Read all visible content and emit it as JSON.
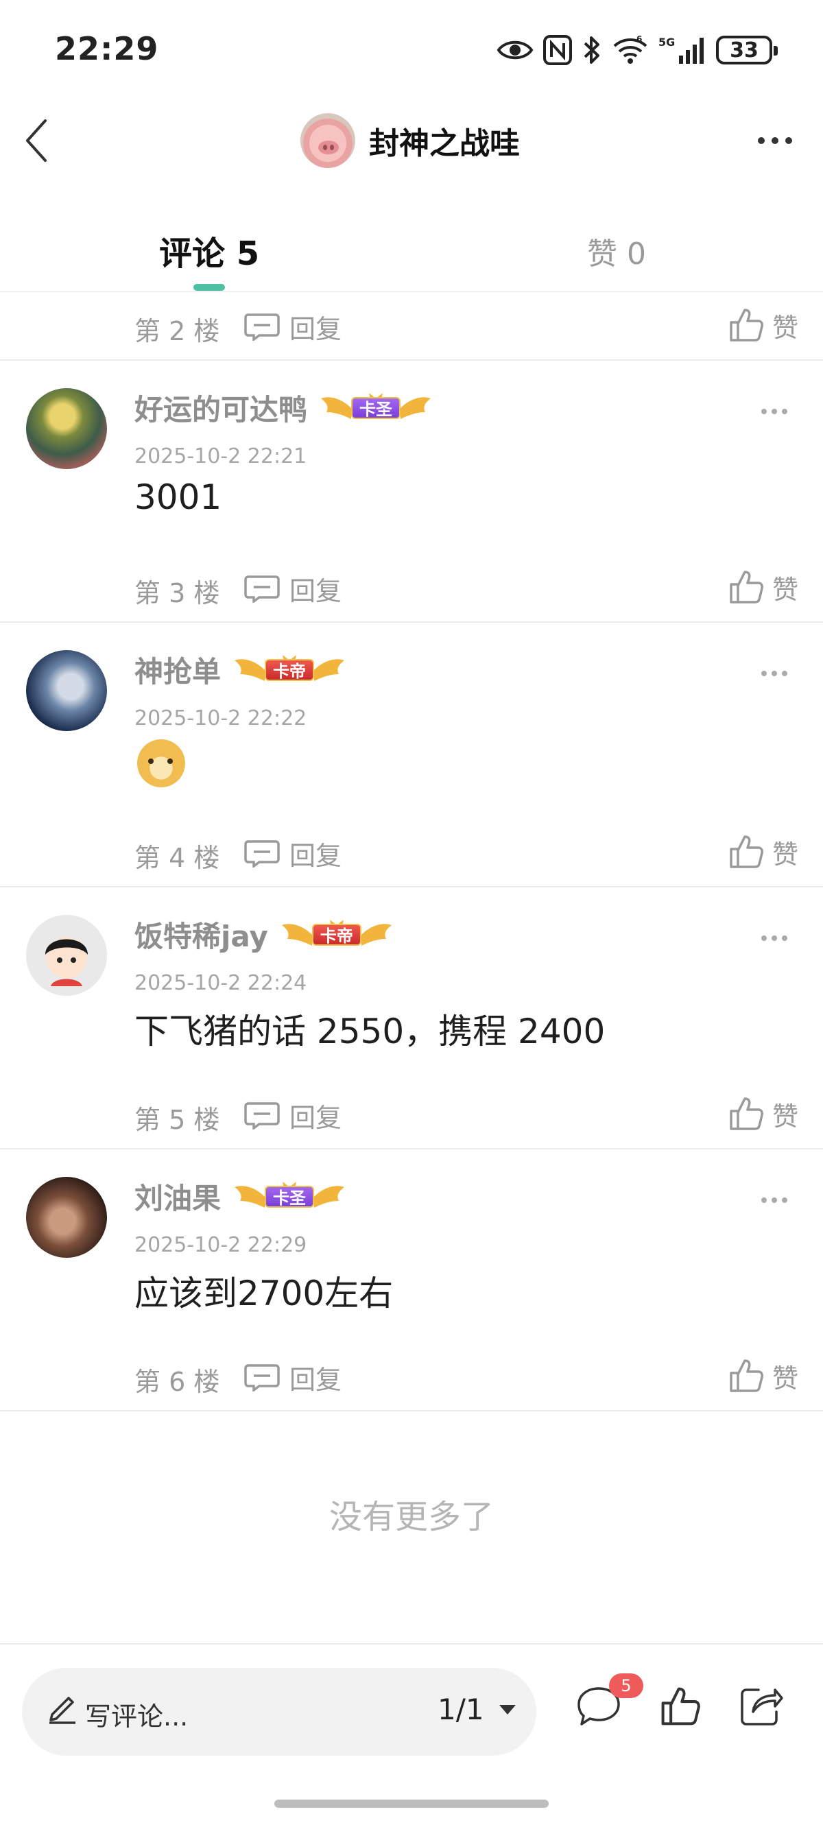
{
  "status_bar": {
    "time": "22:29",
    "battery": "33",
    "icons": [
      "eye-icon",
      "nfc-icon",
      "bluetooth-icon",
      "wifi-icon",
      "5g-signal-icon",
      "battery-icon"
    ]
  },
  "header": {
    "title": "封神之战哇",
    "back_icon": "chevron-left-icon",
    "more_icon": "more-dots-icon"
  },
  "tabs": [
    {
      "label": "评论 5",
      "active": true
    },
    {
      "label": "赞 0",
      "active": false
    }
  ],
  "accent_color": "#4cc0a1",
  "common": {
    "reply_label": "回复",
    "like_label": "赞"
  },
  "partial_top": {
    "floor": "第 2 楼"
  },
  "comments": [
    {
      "username": "好运的可达鸭",
      "badge": "卡圣",
      "badge_color": "purple",
      "time": "2025-10-2 22:21",
      "content": "3001",
      "floor": "第 3 楼"
    },
    {
      "username": "神抢单",
      "badge": "卡帝",
      "badge_color": "red",
      "time": "2025-10-2 22:22",
      "content": "",
      "emoji": "doge-emoji",
      "floor": "第 4 楼"
    },
    {
      "username": "饭特稀jay",
      "badge": "卡帝",
      "badge_color": "red",
      "time": "2025-10-2 22:24",
      "content": "下飞猪的话 2550，携程 2400",
      "floor": "第 5 楼"
    },
    {
      "username": "刘油果",
      "badge": "卡圣",
      "badge_color": "purple",
      "time": "2025-10-2 22:29",
      "content": "应该到2700左右",
      "floor": "第 6 楼"
    }
  ],
  "list_end": "没有更多了",
  "bottom_bar": {
    "input_placeholder": "写评论...",
    "page": "1/1",
    "comment_count": "5",
    "badge_color": "#ef5b5b"
  }
}
